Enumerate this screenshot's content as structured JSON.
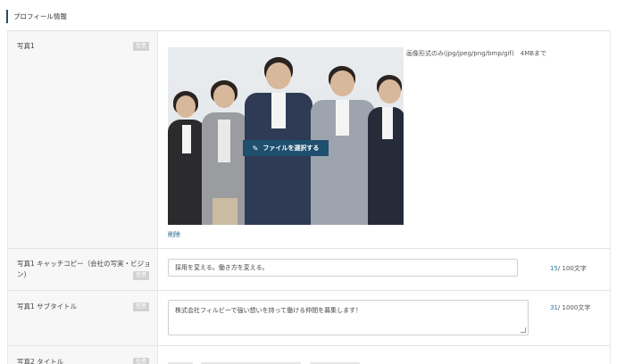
{
  "section": {
    "title": "プロフィール情報"
  },
  "badge_label": "任意",
  "photo1": {
    "label": "写真1",
    "note": "画像形式のみ(jpg/jpeg/png/bmp/gif)　4MBまで",
    "select_button": "ファイルを選択する",
    "delete_link": "削除"
  },
  "catchcopy": {
    "label_line1": "写真1 キャッチコピー（会社の写実・ビジョ",
    "label_line2": "ン)",
    "value": "採用を変える。働き方を変える。",
    "count": "15",
    "max": "/ 100文字"
  },
  "subtitle": {
    "label": "写真1 サブタイトル",
    "value": "株式会社フィルビーで強い想いを持って働ける仲間を募集します！",
    "count": "31",
    "max": "/ 1000文字"
  },
  "photo2_title": {
    "label": "写真2 タイトル"
  },
  "colors": {
    "accent": "#1e4f6e",
    "link": "#1e5f8a",
    "badge": "#d2d2d2"
  }
}
